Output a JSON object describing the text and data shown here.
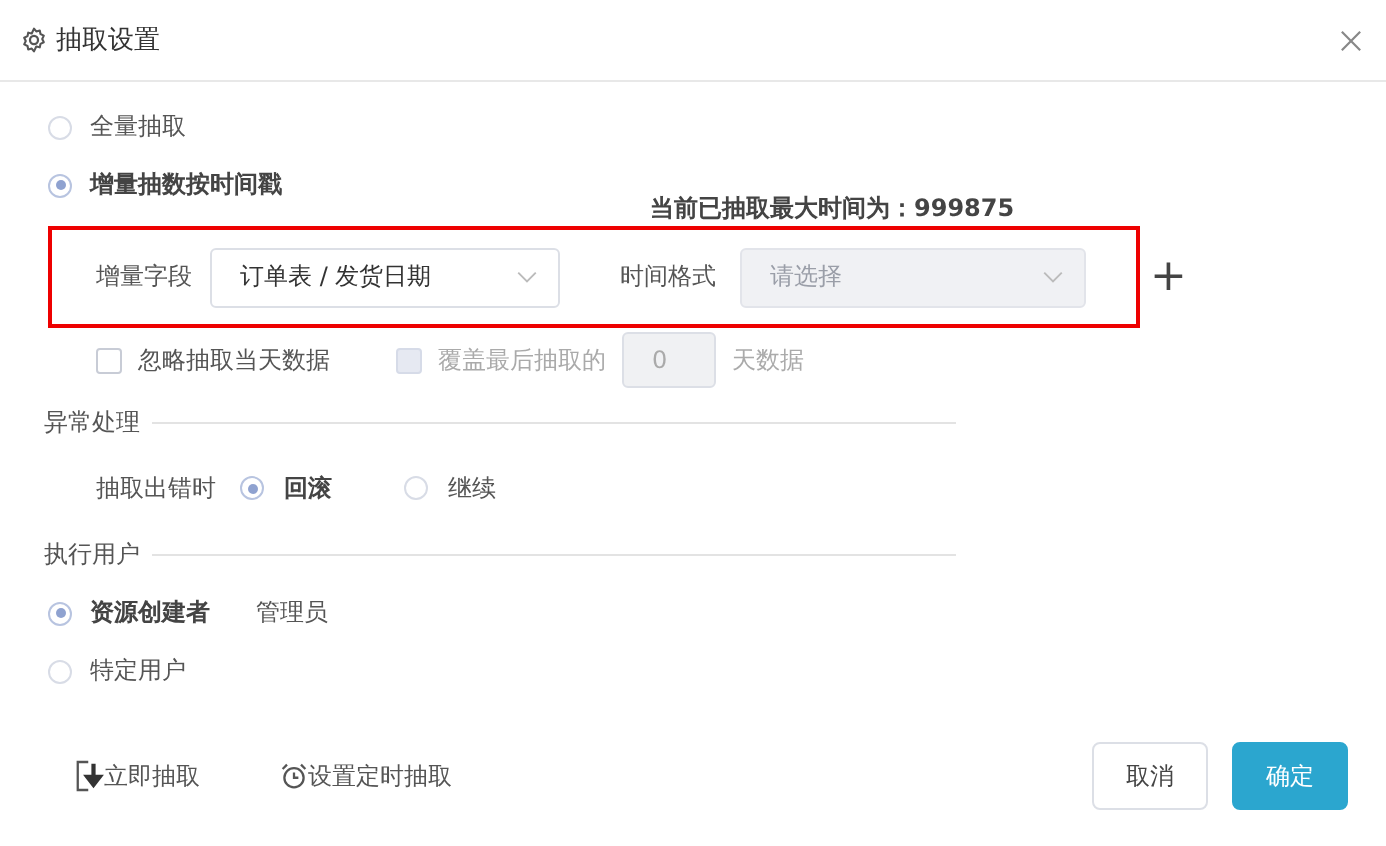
{
  "window": {
    "title": "抽取设置"
  },
  "extract_modes": [
    {
      "label": "全量抽取",
      "selected": false
    },
    {
      "label": "增量抽数按时间戳",
      "selected": true
    }
  ],
  "max_time": "当前已抽取最大时间为：999875",
  "increment_field": {
    "label": "增量字段",
    "value": "订单表 / 发货日期"
  },
  "time_format": {
    "label": "时间格式",
    "placeholder": "请选择",
    "disabled": true
  },
  "add_button": "+",
  "options": [
    {
      "label": "忽略抽取当天数据",
      "checked": false,
      "disabled": false
    },
    {
      "label": "覆盖最后抽取的",
      "checked": false,
      "disabled": true
    }
  ],
  "days": {
    "value": "0",
    "suffix": "天数据",
    "disabled": true
  },
  "error_section": {
    "title": "异常处理",
    "label": "抽取出错时",
    "choices": [
      {
        "label": "回滚",
        "selected": true
      },
      {
        "label": "继续",
        "selected": false
      }
    ]
  },
  "user_section": {
    "title": "执行用户",
    "choices": [
      {
        "label": "资源创建者",
        "selected": true,
        "note": "管理员"
      },
      {
        "label": "特定用户",
        "selected": false
      }
    ]
  },
  "actions": [
    {
      "kind": "download",
      "label": "立即抽取"
    },
    {
      "kind": "alarm",
      "label": "设置定时抽取"
    }
  ],
  "buttons": [
    {
      "label": "取消",
      "primary": false
    },
    {
      "label": "确定",
      "primary": true
    }
  ]
}
